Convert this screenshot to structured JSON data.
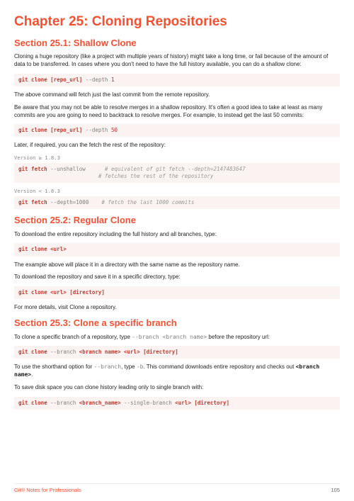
{
  "chapter": {
    "title": "Chapter 25: Cloning Repositories"
  },
  "s1": {
    "heading": "Section 25.1: Shallow Clone",
    "p1": "Cloning a huge repository (like a project with multiple years of history) might take a long time, or fail because of the amount of data to be transferred. In cases where you don't need to have the full history available, you can do a shallow clone:",
    "code1_kw": "git clone",
    "code1_arg": "[repo_url]",
    "code1_opt": "--depth",
    "code1_n": "1",
    "p2": "The above command will fetch just the last commit from the remote repository.",
    "p3": "Be aware that you may not be able to resolve merges in a shallow repository. It's often a good idea to take at least as many commits are you are going to need to backtrack to resolve merges. For example, to instead get the last 50 commits:",
    "code2_kw": "git clone",
    "code2_arg": "[repo_url]",
    "code2_opt": "--depth",
    "code2_n": "50",
    "p4": "Later, if required, you can the fetch the rest of the repository:",
    "ver1": "Version ≥ 1.8.3",
    "code3_kw": "git fetch",
    "code3_opt": "--unshallow",
    "code3_cmt1": "# equivalent of git fetch --depth=2147483647",
    "code3_cmt2": "# fetches the rest of the repository",
    "ver2": "Version < 1.8.3",
    "code4_kw": "git fetch",
    "code4_opt": "--depth=1000",
    "code4_cmt": "# fetch the last 1000 commits"
  },
  "s2": {
    "heading": "Section 25.2: Regular Clone",
    "p1": "To download the entire repository including the full history and all branches, type:",
    "code1_kw": "git clone",
    "code1_arg": "<url>",
    "p2": "The example above will place it in a directory with the same name as the repository name.",
    "p3": "To download the repository and save it in a specific directory, type:",
    "code2_kw": "git clone",
    "code2_arg1": "<url>",
    "code2_arg2": "[directory]",
    "p4": "For more details, visit Clone a repository."
  },
  "s3": {
    "heading": "Section 25.3: Clone a specific branch",
    "p1a": "To clone a specific branch of a repository, type ",
    "p1b": "--branch",
    "p1c": " <branch name>",
    "p1d": " before the repository url:",
    "code1_kw": "git clone",
    "code1_opt": "--branch",
    "code1_b": "<branch name>",
    "code1_u": "<url>",
    "code1_d": "[directory]",
    "p2a": "To use the shorthand option for ",
    "p2b": "--branch",
    "p2c": ", type ",
    "p2d": "-b",
    "p2e": ". This command downloads entire repository and checks out ",
    "p2f": "<branch name>",
    "p2g": ".",
    "p3": "To save disk space you can clone history leading only to single branch with:",
    "code2_kw": "git clone",
    "code2_opt1": "--branch",
    "code2_b": "<branch_name>",
    "code2_opt2": "--single-branch",
    "code2_u": "<url>",
    "code2_d": "[directory]"
  },
  "footer": {
    "left": "Git® Notes for Professionals",
    "right": "105"
  }
}
